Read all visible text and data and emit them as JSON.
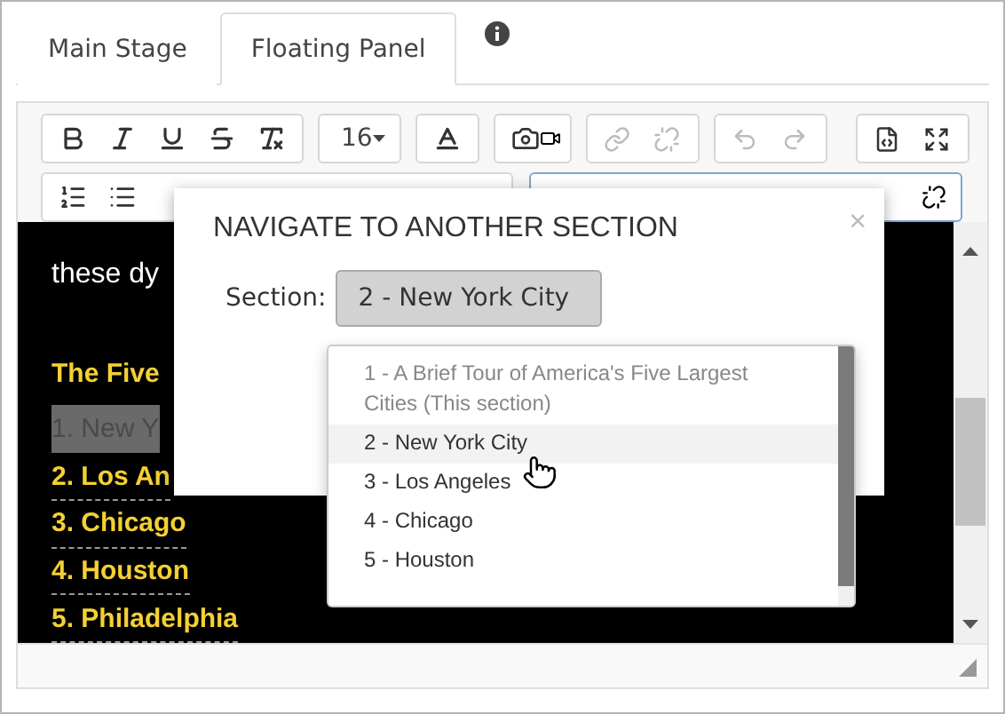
{
  "tabs": [
    {
      "label": "Main Stage",
      "selected": false
    },
    {
      "label": "Floating Panel",
      "selected": true
    }
  ],
  "toolbar": {
    "font_size": "16"
  },
  "content": {
    "intro": "these dy",
    "heading": "The Five",
    "items": [
      {
        "text": "1. New Y",
        "selected": true
      },
      {
        "text": "2. Los An",
        "selected": false
      },
      {
        "text": "3. Chicago",
        "selected": false
      },
      {
        "text": "4. Houston",
        "selected": false
      },
      {
        "text": "5. Philadelphia",
        "selected": false
      }
    ]
  },
  "modal": {
    "title": "NAVIGATE TO ANOTHER SECTION",
    "close": "×",
    "section_label": "Section:",
    "selected_value": "2 - New York City",
    "options": [
      {
        "label": "1 - A Brief Tour of America's Five Largest Cities (This section)",
        "disabled": true,
        "hovered": false
      },
      {
        "label": "2 - New York City",
        "disabled": false,
        "hovered": true
      },
      {
        "label": "3 - Los Angeles",
        "disabled": false,
        "hovered": false
      },
      {
        "label": "4 - Chicago",
        "disabled": false,
        "hovered": false
      },
      {
        "label": "5 - Houston",
        "disabled": false,
        "hovered": false
      }
    ]
  }
}
